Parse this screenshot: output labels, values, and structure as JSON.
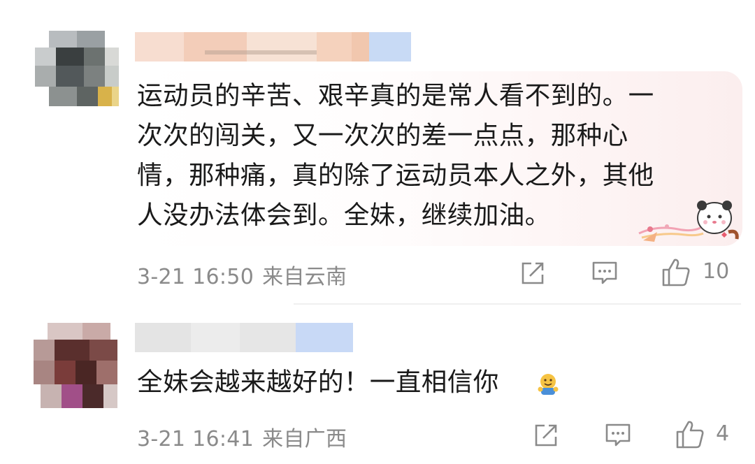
{
  "comments": [
    {
      "text_lines": [
        "运动员的辛苦、艰辛真的是常人看不到的。一",
        "次次的闯关，又一次次的差一点点，那种心",
        "情，那种痛，真的除了运动员本人之外，其他",
        "人没办法体会到。全妹，继续加油。"
      ],
      "time": "3-21 16:50",
      "location": "来自云南",
      "likes": "10",
      "icons": {
        "share": "share-icon",
        "reply": "comment-icon",
        "like": "thumbs-up-icon"
      }
    },
    {
      "text": "全妹会越来越好的！一直相信你",
      "time": "3-21 16:41",
      "location": "来自广西",
      "likes": "4",
      "icons": {
        "share": "share-icon",
        "reply": "comment-icon",
        "like": "thumbs-up-icon"
      }
    }
  ],
  "colors": {
    "text": "#1a1a1a",
    "meta": "#8a8a8a",
    "bubble_tint": "#fbeeee",
    "divider": "#f0f0f0"
  }
}
